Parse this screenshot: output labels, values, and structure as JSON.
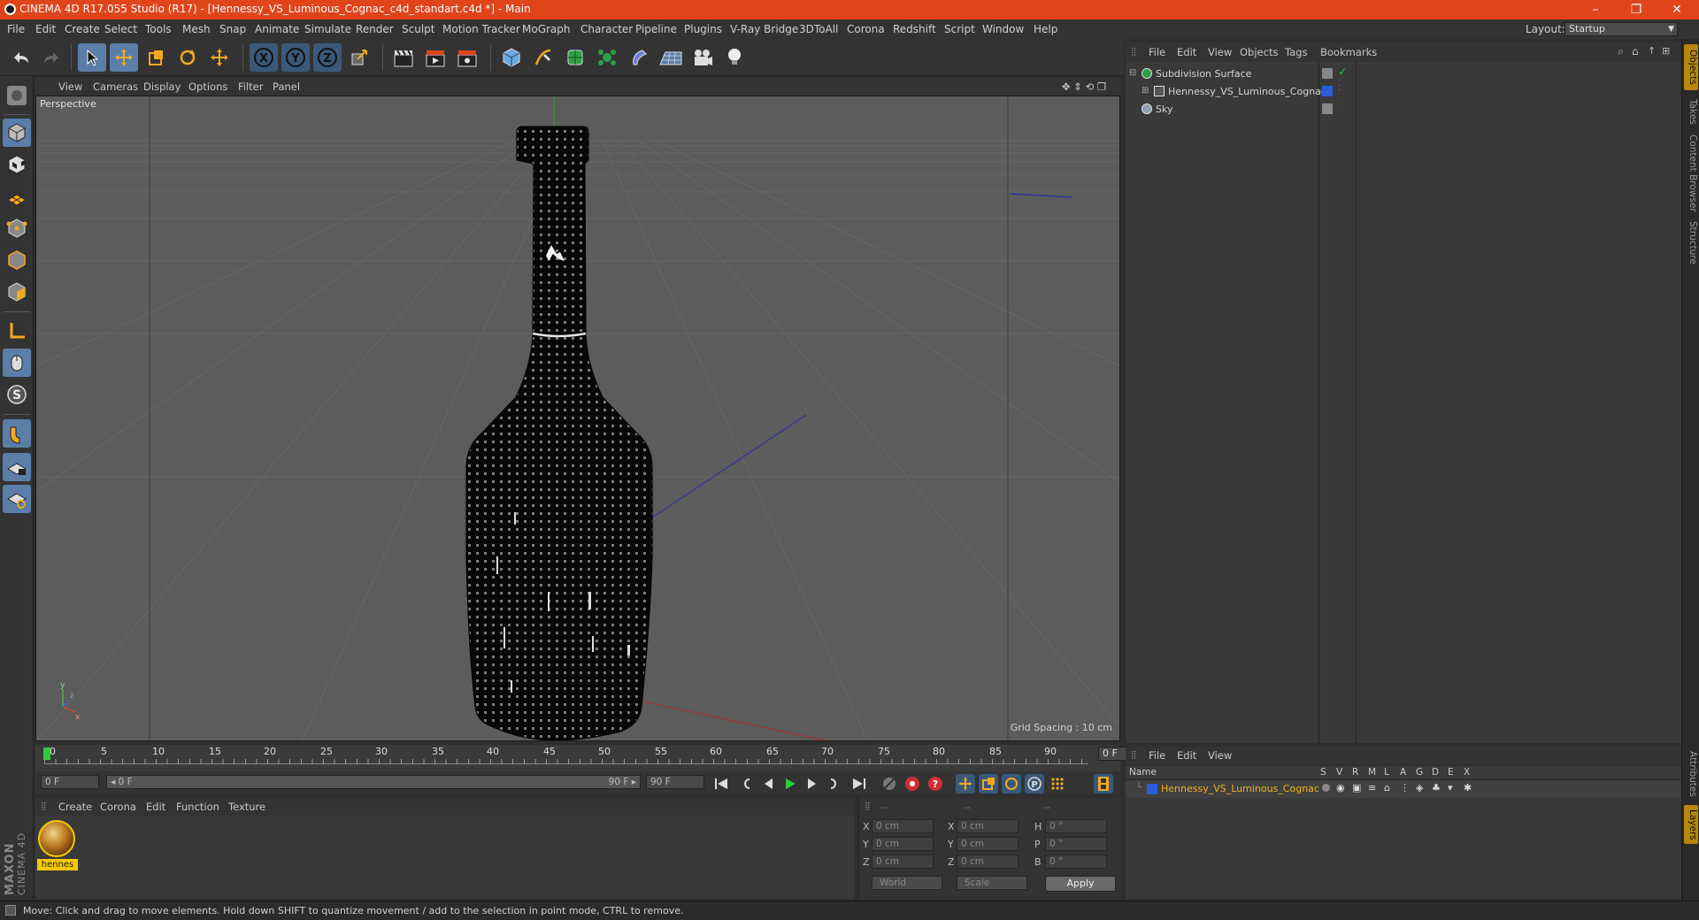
{
  "window": {
    "title": "CINEMA 4D R17.055 Studio (R17) - [Hennessy_VS_Luminous_Cognac_c4d_standart.c4d *] - Main",
    "minimize": "–",
    "restore": "❐",
    "close": "✕"
  },
  "menubar": {
    "items": [
      "File",
      "Edit",
      "Create",
      "Select",
      "Tools",
      "Mesh",
      "Snap",
      "Animate",
      "Simulate",
      "Render",
      "Sculpt",
      "Motion Tracker",
      "MoGraph",
      "Character",
      "Pipeline",
      "Plugins",
      "V-Ray Bridge",
      "3DToAll",
      "Corona",
      "Redshift",
      "Script",
      "Window",
      "Help"
    ],
    "layout_label": "Layout:",
    "layout_value": "Startup"
  },
  "toolbar": {
    "axis_x": "X",
    "axis_y": "Y",
    "axis_z": "Z"
  },
  "viewport": {
    "menu": [
      "View",
      "Cameras",
      "Display",
      "Options",
      "Filter",
      "Panel"
    ],
    "label": "Perspective",
    "grid_spacing": "Grid Spacing : 10 cm",
    "nav_icons": "✥ ⇕ ⟲ ❐"
  },
  "timeline": {
    "ticks": [
      "0",
      "5",
      "10",
      "15",
      "20",
      "25",
      "30",
      "35",
      "40",
      "45",
      "50",
      "55",
      "60",
      "65",
      "70",
      "75",
      "80",
      "85",
      "90"
    ],
    "current_frame": "0 F",
    "start_field": "0 F",
    "range_start": "◂ 0 F",
    "range_end": "90 F ▸",
    "end_field": "90 F"
  },
  "material_manager": {
    "menu": [
      "Create",
      "Corona",
      "Edit",
      "Function",
      "Texture"
    ],
    "material_name": "hennes"
  },
  "coordinates": {
    "header": [
      "--",
      "--",
      "--"
    ],
    "rows": [
      {
        "l1": "X",
        "v1": "0 cm",
        "l2": "X",
        "v2": "0 cm",
        "l3": "H",
        "v3": "0 °"
      },
      {
        "l1": "Y",
        "v1": "0 cm",
        "l2": "Y",
        "v2": "0 cm",
        "l3": "P",
        "v3": "0 °"
      },
      {
        "l1": "Z",
        "v1": "0 cm",
        "l2": "Z",
        "v2": "0 cm",
        "l3": "B",
        "v3": "0 °"
      }
    ],
    "space": "World",
    "mode": "Scale",
    "apply": "Apply"
  },
  "object_manager": {
    "menu": [
      "File",
      "Edit",
      "View",
      "Objects",
      "Tags",
      "Bookmarks"
    ],
    "objects": [
      {
        "name": "Subdivision Surface"
      },
      {
        "name": "Hennessy_VS_Luminous_Cognac"
      },
      {
        "name": "Sky"
      }
    ]
  },
  "layer_manager": {
    "menu": [
      "File",
      "Edit",
      "View"
    ],
    "columns": [
      "Name",
      "S",
      "V",
      "R",
      "M",
      "L",
      "A",
      "G",
      "D",
      "E",
      "X"
    ],
    "layer_name": "Hennessy_VS_Luminous_Cognac"
  },
  "right_tabs": [
    "Objects",
    "Takes",
    "Content Browser",
    "Structure",
    "Attributes",
    "Layers"
  ],
  "status": {
    "text": "Move: Click and drag to move elements. Hold down SHIFT to quantize movement / add to the selection in point mode, CTRL to remove."
  },
  "branding": {
    "maxon": "MAXON",
    "cinema": "CINEMA 4D"
  },
  "colors": {
    "titlebar": "#e0441a",
    "accent": "#5a7ea8",
    "selection_yellow": "#f5c800",
    "layer_blue": "#2f5bd8",
    "layer_name": "#f2b31e"
  }
}
